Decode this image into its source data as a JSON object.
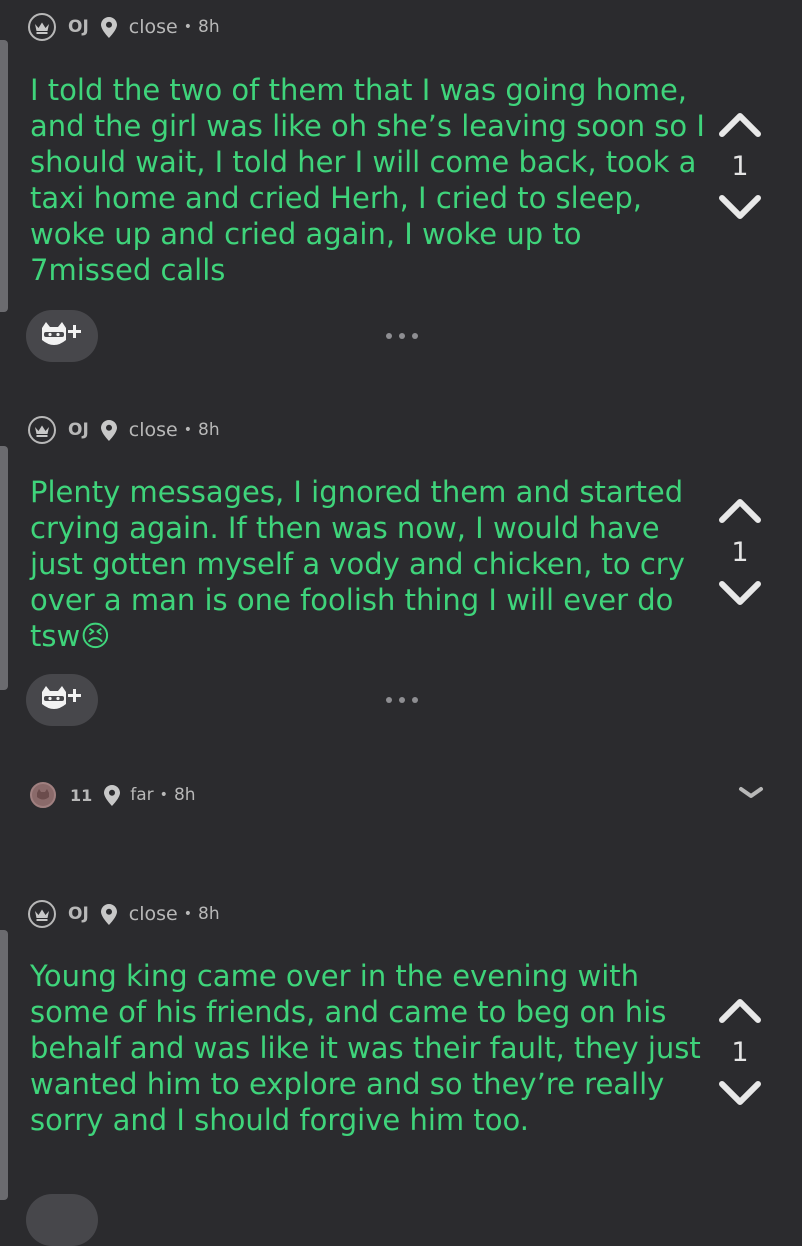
{
  "comments": [
    {
      "username": "OJ",
      "location": "close",
      "time": "8h",
      "text": "I told the two of them that I was going home, and the girl was like oh she’s leaving soon so I should wait, I told her I will come back, took a taxi home and cried Herh, I cried to sleep, woke up and cried again, I woke up to 7missed calls",
      "votes": "1"
    },
    {
      "username": "OJ",
      "location": "close",
      "time": "8h",
      "text": "Plenty messages, I ignored them and started crying again. If then was now, I would have just gotten myself a vody and chicken, to cry over a man is one foolish thing I will ever do tsw😣",
      "votes": "1"
    },
    {
      "username": "OJ",
      "location": "close",
      "time": "8h",
      "text": "Young king came over in the evening with some of his friends, and came to beg on his behalf and was like it was their fault, they just wanted him to explore and so they’re really sorry and I should forgive him too.",
      "votes": "1"
    }
  ],
  "collapsed_reply": {
    "count": "11",
    "location": "far",
    "time": "8h"
  },
  "icons": {
    "badge": "crown-icon",
    "location": "location-pin-icon",
    "upvote": "chevron-up-icon",
    "downvote": "chevron-down-icon",
    "reaction": "add-reaction-icon",
    "more": "more-dots-icon",
    "expand": "expand-chevron-icon"
  },
  "colors": {
    "background": "#2b2b2e",
    "text": "#3fd47b",
    "meta": "#b8b8b8"
  }
}
